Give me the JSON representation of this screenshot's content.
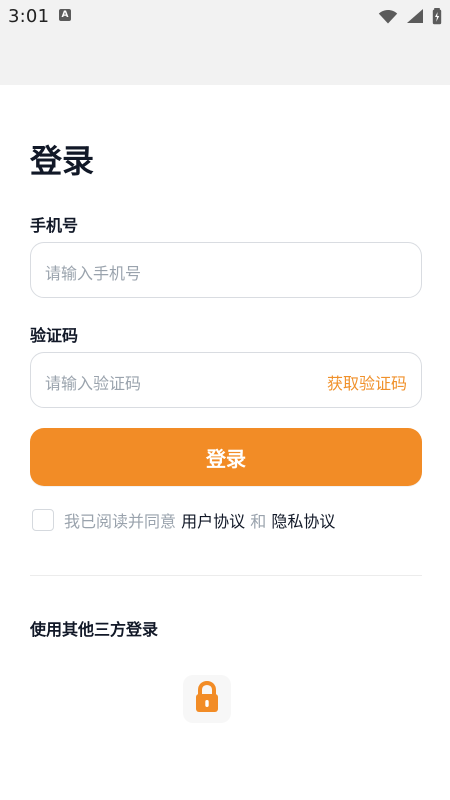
{
  "statusbar": {
    "time": "3:01",
    "keyboard_badge": "A"
  },
  "page": {
    "title": "登录"
  },
  "phone": {
    "label": "手机号",
    "placeholder": "请输入手机号"
  },
  "code": {
    "label": "验证码",
    "placeholder": "请输入验证码",
    "action_label": "获取验证码"
  },
  "login_button": {
    "label": "登录"
  },
  "agreement": {
    "prefix": "我已阅读并同意",
    "user_agreement": "用户协议",
    "and_text": "和",
    "privacy_agreement": "隐私协议",
    "checked": false
  },
  "third_party": {
    "label": "使用其他三方登录",
    "icons": [
      "lock-icon"
    ]
  },
  "colors": {
    "accent": "#f28c26",
    "accent_text": "#f0912b",
    "placeholder": "#9aa3ad",
    "title": "#111827",
    "top_band": "#f2f2f2",
    "border": "#d9dce1"
  },
  "icons": {
    "wifi": "wifi-icon",
    "signal": "signal-icon",
    "battery": "battery-icon",
    "keyboard_badge": "keyboard-badge-icon",
    "third_party_lock": "lock-icon"
  }
}
